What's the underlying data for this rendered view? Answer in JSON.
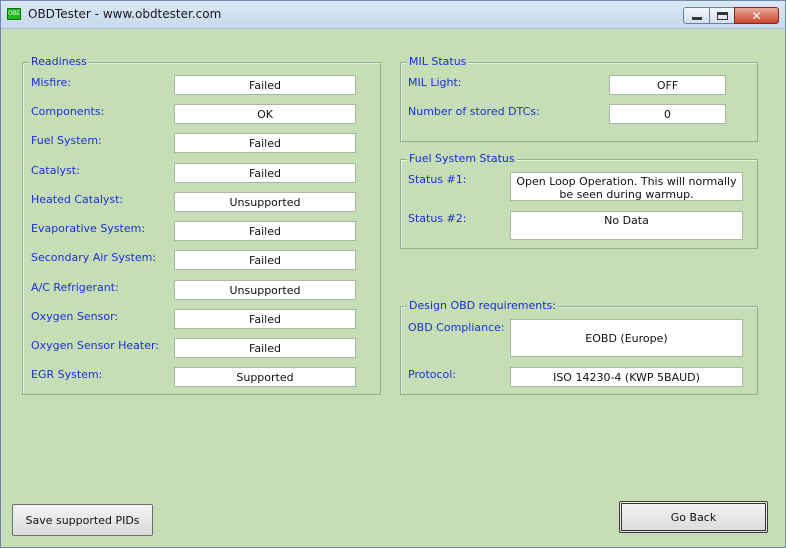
{
  "window": {
    "title": "OBDTester - www.obdtester.com",
    "icon_text": "OBD"
  },
  "readiness": {
    "title": "Readiness",
    "items": [
      {
        "label": "Misfire:",
        "value": "Failed"
      },
      {
        "label": "Components:",
        "value": "OK"
      },
      {
        "label": "Fuel System:",
        "value": "Failed"
      },
      {
        "label": "Catalyst:",
        "value": "Failed"
      },
      {
        "label": "Heated Catalyst:",
        "value": "Unsupported"
      },
      {
        "label": "Evaporative System:",
        "value": "Failed"
      },
      {
        "label": "Secondary Air System:",
        "value": "Failed"
      },
      {
        "label": "A/C Refrigerant:",
        "value": "Unsupported"
      },
      {
        "label": "Oxygen Sensor:",
        "value": "Failed"
      },
      {
        "label": "Oxygen Sensor Heater:",
        "value": "Failed"
      },
      {
        "label": "EGR System:",
        "value": "Supported"
      }
    ]
  },
  "mil": {
    "title": "MIL Status",
    "light_label": "MIL Light:",
    "light_value": "OFF",
    "dtc_label": "Number of stored DTCs:",
    "dtc_value": "0"
  },
  "fuel_status": {
    "title": "Fuel System Status",
    "status1_label": "Status #1:",
    "status1_value": "Open Loop Operation. This will normally be seen during warmup.",
    "status2_label": "Status #2:",
    "status2_value": "No Data"
  },
  "obd_req": {
    "title": "Design OBD requirements:",
    "compliance_label": "OBD Compliance:",
    "compliance_value": "EOBD (Europe)",
    "protocol_label": "Protocol:",
    "protocol_value": "ISO 14230-4 (KWP 5BAUD)"
  },
  "buttons": {
    "save": "Save supported PIDs",
    "back": "Go Back"
  }
}
